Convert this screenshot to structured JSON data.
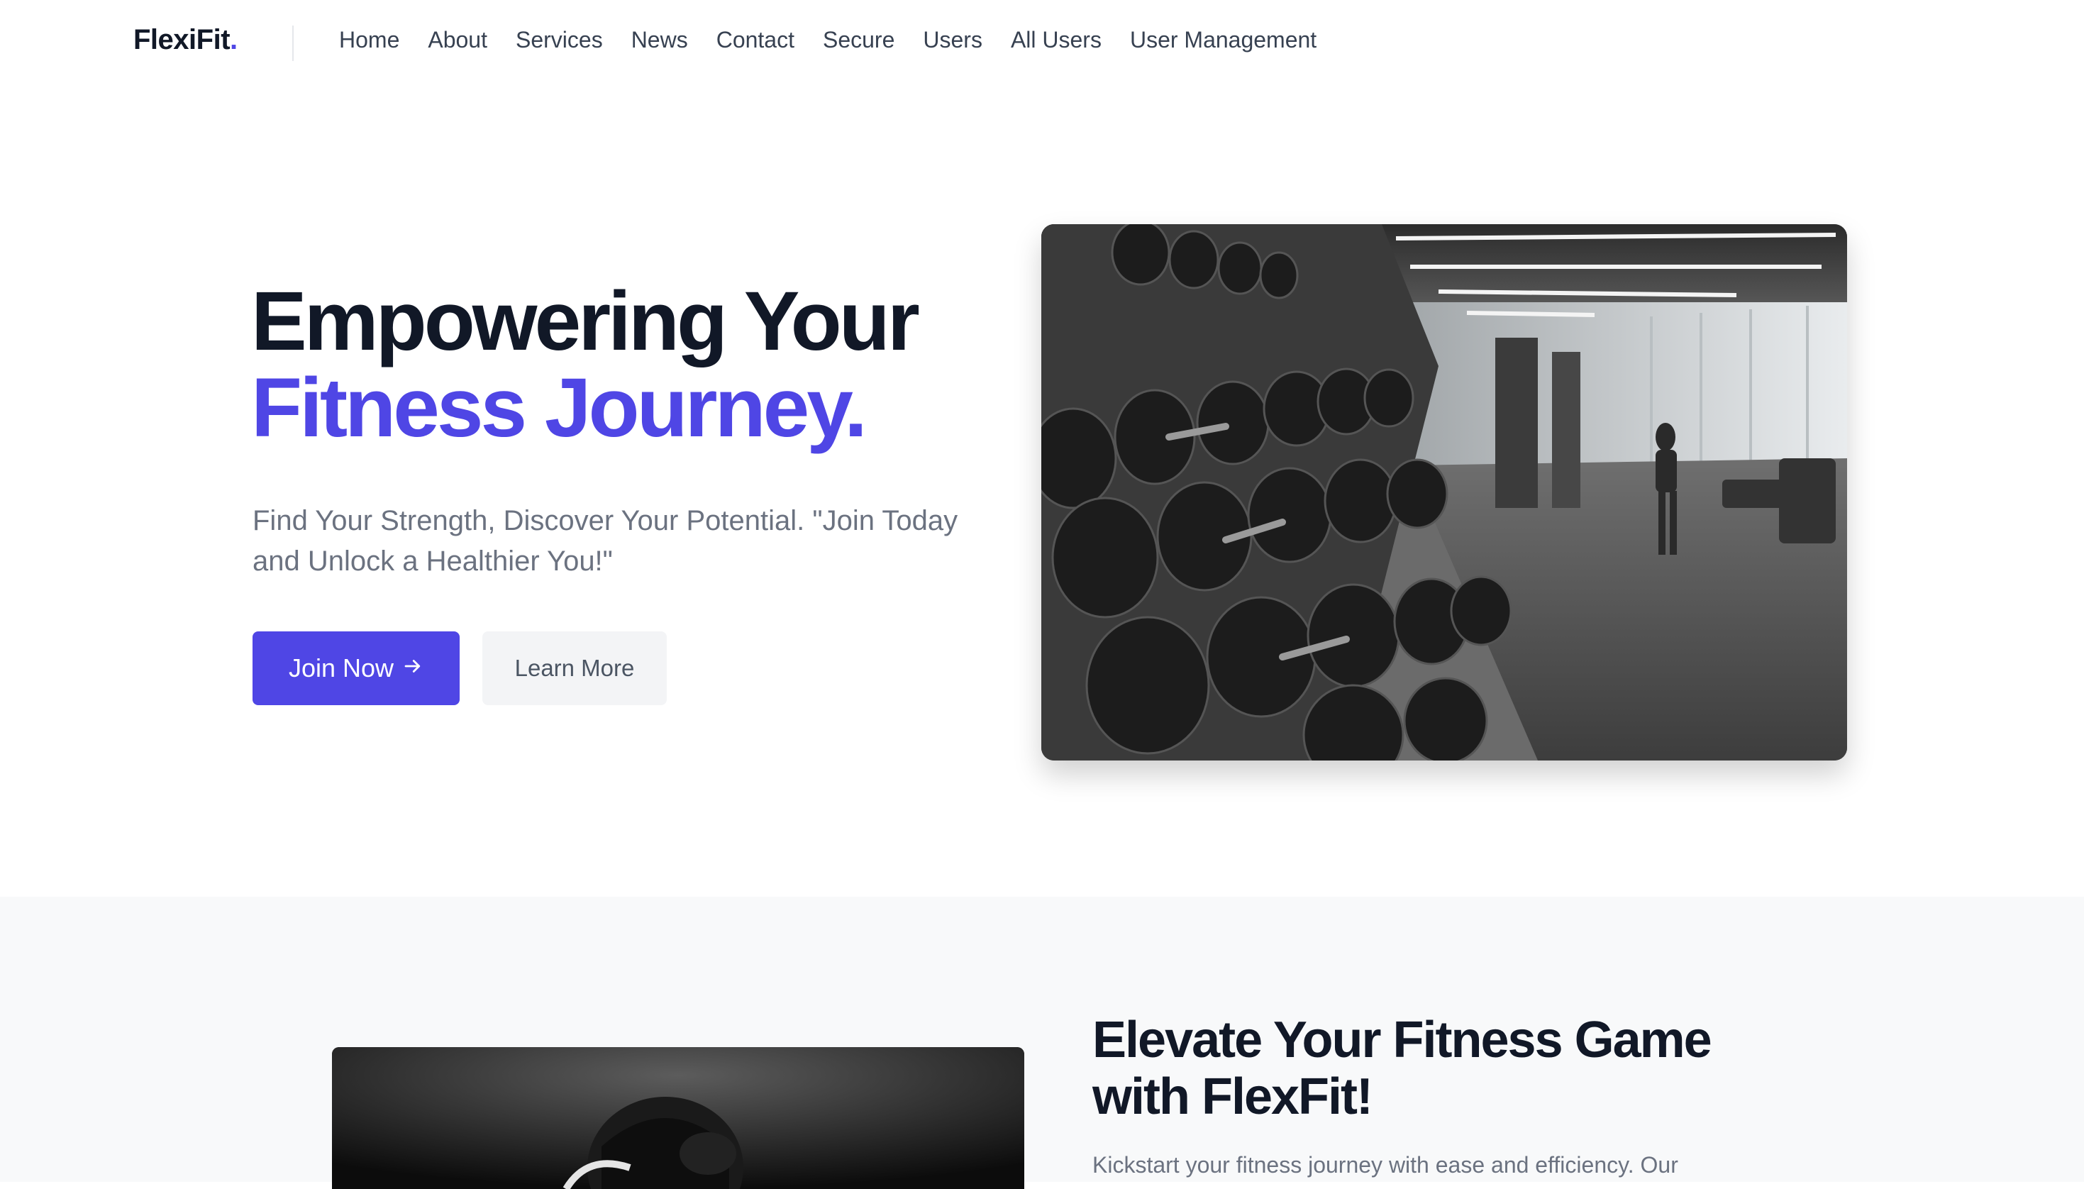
{
  "nav": {
    "logo": "FlexiFit",
    "logo_dot": ".",
    "links": [
      "Home",
      "About",
      "Services",
      "News",
      "Contact",
      "Secure",
      "Users",
      "All Users",
      "User Management"
    ]
  },
  "hero": {
    "title_line1": "Empowering Your",
    "title_line2": "Fitness Journey.",
    "subtitle": "Find Your Strength, Discover Your Potential. \"Join Today and Unlock a Healthier You!\"",
    "primary_button": "Join Now",
    "secondary_button": "Learn More",
    "image_icon": "gym-dumbbell-rack-photo"
  },
  "section2": {
    "title": "Elevate Your Fitness Game with FlexFit!",
    "text": "Kickstart your fitness journey with ease and efficiency. Our",
    "image_icon": "woman-lifting-photo"
  },
  "colors": {
    "accent": "#4f46e5",
    "text_dark": "#111827",
    "text_muted": "#6b7280",
    "section_bg": "#f8f9fa"
  }
}
